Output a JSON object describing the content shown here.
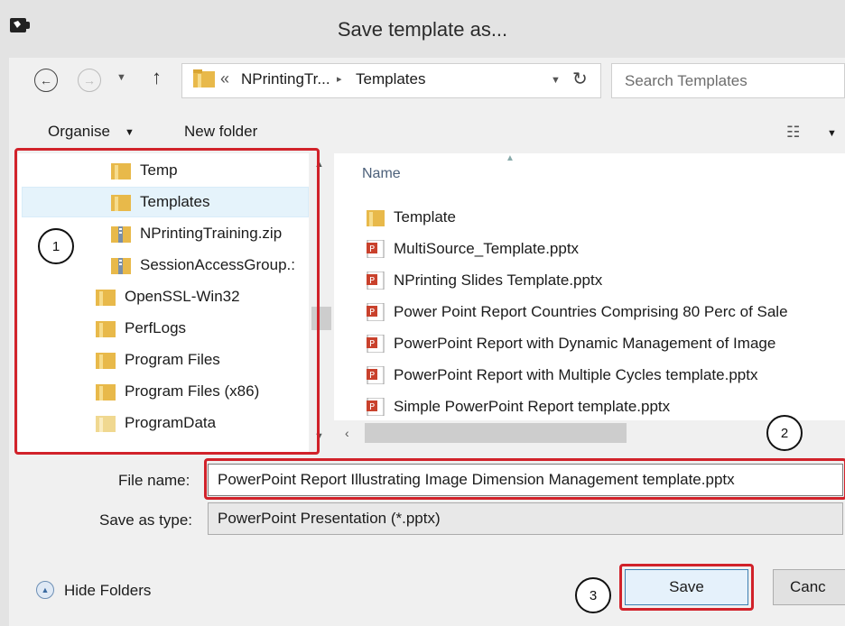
{
  "window": {
    "title": "Save template as..."
  },
  "address_bar": {
    "overflow": "«",
    "segments": [
      "NPrintingTr...",
      "Templates"
    ],
    "separator": "▸"
  },
  "search": {
    "placeholder": "Search Templates"
  },
  "toolbar": {
    "organise_label": "Organise",
    "new_folder_label": "New folder"
  },
  "nav_tree": [
    {
      "label": "Temp",
      "icon": "folder-icon"
    },
    {
      "label": "Templates",
      "icon": "folder-icon",
      "selected": true
    },
    {
      "label": "NPrintingTraining.zip",
      "icon": "zip-folder-icon"
    },
    {
      "label": "SessionAccessGroup.:",
      "icon": "zip-folder-icon"
    },
    {
      "label": "OpenSSL-Win32",
      "icon": "folder-icon"
    },
    {
      "label": "PerfLogs",
      "icon": "folder-icon"
    },
    {
      "label": "Program Files",
      "icon": "folder-icon"
    },
    {
      "label": "Program Files (x86)",
      "icon": "folder-icon"
    },
    {
      "label": "ProgramData",
      "icon": "folder-icon"
    }
  ],
  "file_list": {
    "column_name": "Name",
    "items": [
      {
        "label": "Template",
        "icon": "folder-icon"
      },
      {
        "label": "MultiSource_Template.pptx",
        "icon": "pptx-icon"
      },
      {
        "label": "NPrinting Slides Template.pptx",
        "icon": "pptx-icon"
      },
      {
        "label": "Power Point Report Countries Comprising 80 Perc of Sale",
        "icon": "pptx-icon"
      },
      {
        "label": "PowerPoint Report with Dynamic Management of Image",
        "icon": "pptx-icon"
      },
      {
        "label": "PowerPoint Report with Multiple Cycles template.pptx",
        "icon": "pptx-icon"
      },
      {
        "label": "Simple PowerPoint Report template.pptx",
        "icon": "pptx-icon"
      }
    ]
  },
  "fields": {
    "file_name_label": "File name:",
    "file_name_value": "PowerPoint Report Illustrating Image Dimension Management template.pptx",
    "save_type_label": "Save as type:",
    "save_type_value": "PowerPoint Presentation (*.pptx)"
  },
  "footer": {
    "hide_folders_label": "Hide Folders",
    "save_label": "Save",
    "cancel_label": "Canc"
  },
  "annotations": {
    "callout_1": "1",
    "callout_2": "2",
    "callout_3": "3"
  },
  "colors": {
    "highlight_red": "#d1222a",
    "folder_yellow": "#e8b94a",
    "pptx_red": "#c9412c",
    "selected_bg": "#e5f3fb"
  }
}
